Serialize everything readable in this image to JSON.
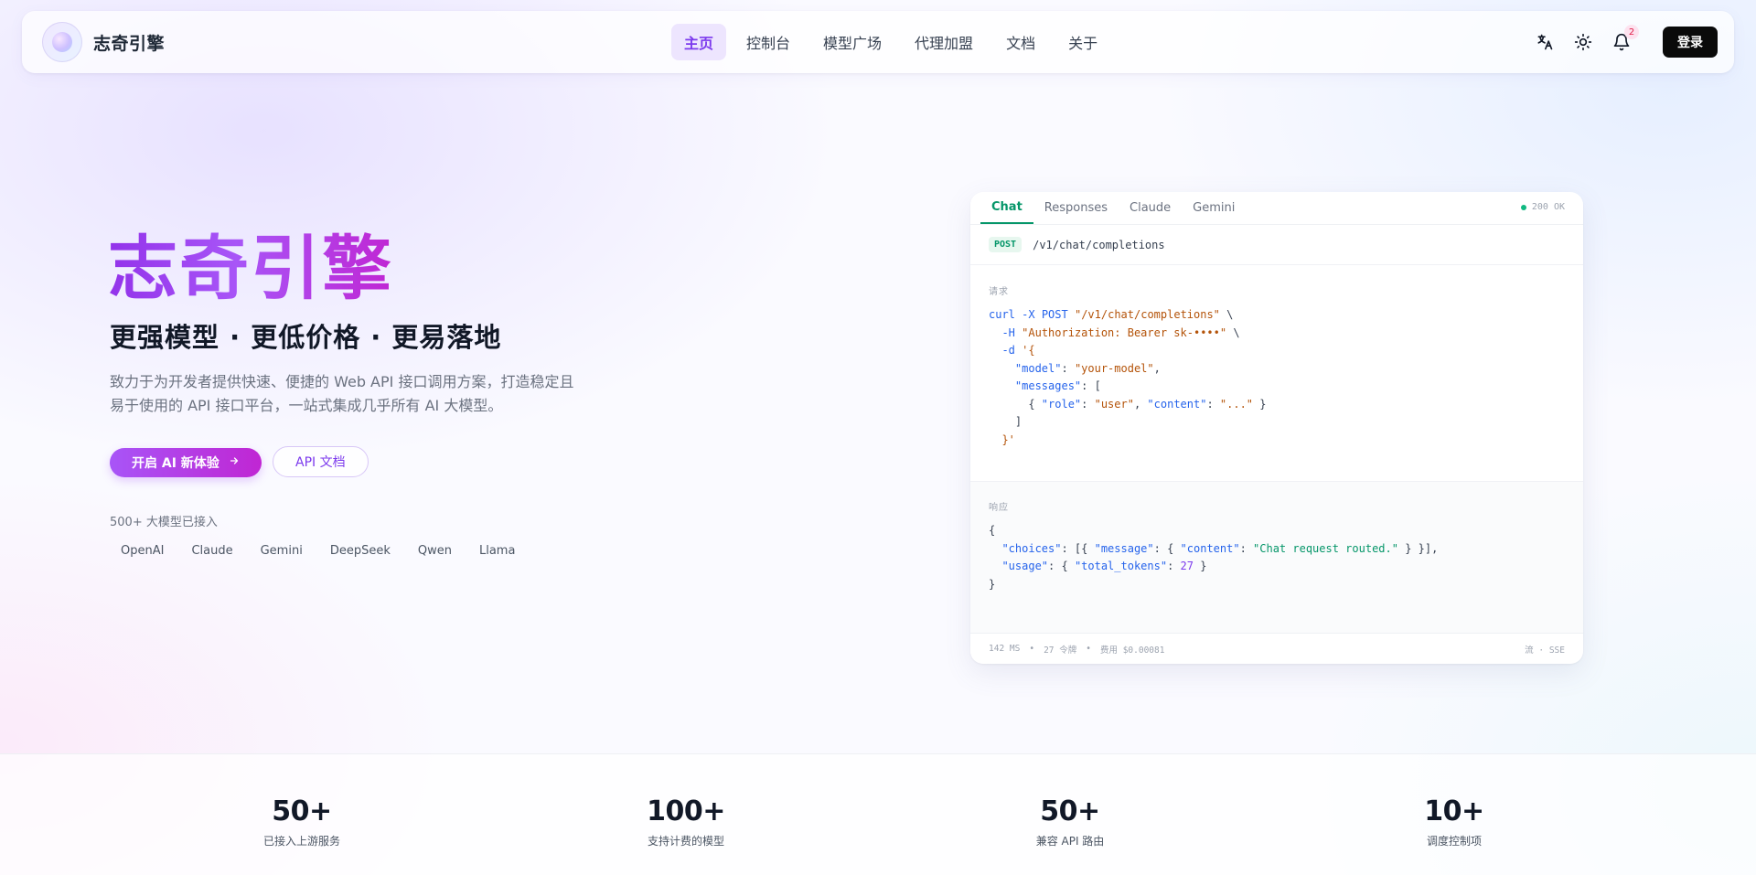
{
  "brand": {
    "name": "志奇引擎"
  },
  "nav": {
    "links": [
      {
        "label": "主页"
      },
      {
        "label": "控制台"
      },
      {
        "label": "模型广场"
      },
      {
        "label": "代理加盟"
      },
      {
        "label": "文档"
      },
      {
        "label": "关于"
      }
    ],
    "notification_count": "2",
    "login_label": "登录",
    "icons": [
      "translate-icon",
      "sun-icon",
      "bell-icon"
    ]
  },
  "hero": {
    "title": "志奇引擎",
    "subtitle": "更强模型 · 更低价格 · 更易落地",
    "description": "致力于为开发者提供快速、便捷的 Web API 接口调用方案，打造稳定且易于使用的 API 接口平台，一站式集成几乎所有 AI 大模型。",
    "cta_primary": "开启 AI 新体验",
    "cta_secondary": "API 文档",
    "models_caption": "500+ 大模型已接入",
    "models": [
      "OpenAI",
      "Claude",
      "Gemini",
      "DeepSeek",
      "Qwen",
      "Llama"
    ]
  },
  "card": {
    "tabs": [
      "Chat",
      "Responses",
      "Claude",
      "Gemini"
    ],
    "status": "200 OK",
    "method": "POST",
    "path": "/v1/chat/completions",
    "request_label": "请求",
    "response_label": "响应",
    "footer": {
      "latency": "142 MS",
      "tokens": "27 令牌",
      "cost": "费用 $0.00081",
      "mode": "流 · SSE"
    }
  },
  "stats": [
    {
      "value": "50+",
      "label": "已接入上游服务"
    },
    {
      "value": "100+",
      "label": "支持计费的模型"
    },
    {
      "value": "50+",
      "label": "兼容 API 路由"
    },
    {
      "value": "10+",
      "label": "调度控制项"
    }
  ],
  "colors": {
    "accent": "#7c3aed",
    "brand_gradient_start": "#9333ea",
    "brand_gradient_end": "#c026d3",
    "success": "#059669"
  }
}
